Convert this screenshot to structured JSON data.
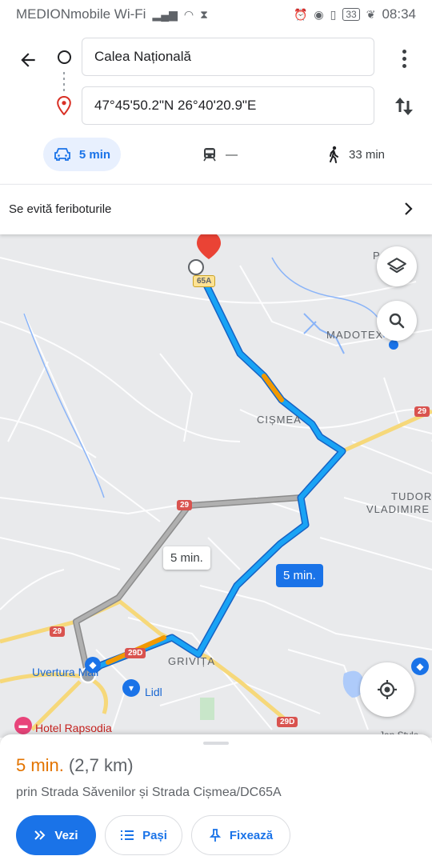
{
  "status_bar": {
    "carrier": "MEDIONmobile Wi-Fi",
    "battery": "33",
    "time": "08:34"
  },
  "directions": {
    "origin": "Calea Națională",
    "destination": "47°45'50.2\"N 26°40'20.9\"E"
  },
  "modes": {
    "drive": "5 min",
    "transit": "—",
    "walk": "33 min"
  },
  "avoid_banner": "Se evită feriboturile",
  "map": {
    "labels": {
      "cismea": "CIȘMEA",
      "madotex": "MADOTEX",
      "tudor": "TUDOR",
      "vladimirescu": "VLADIMIRE",
      "grivita": "GRIVIȚA",
      "uvertura": "Uvertura Mall",
      "lidl": "Lidl",
      "hotel": "Hotel Rapsodia",
      "partial_top": "P",
      "partial_bottom": "Jan Style"
    },
    "shields": {
      "r65a": "65A",
      "r29_right": "29",
      "r29_mid": "29",
      "r29_left": "29",
      "r29d_a": "29D",
      "r29d_b": "29D"
    },
    "callout_alt": "5 min.",
    "callout_main": "5 min."
  },
  "sheet": {
    "time": "5 min.",
    "distance": "(2,7 km)",
    "via": "prin Strada Săvenilor și Strada Cișmea/DC65A",
    "go": "Vezi",
    "steps": "Pași",
    "pin": "Fixează"
  }
}
